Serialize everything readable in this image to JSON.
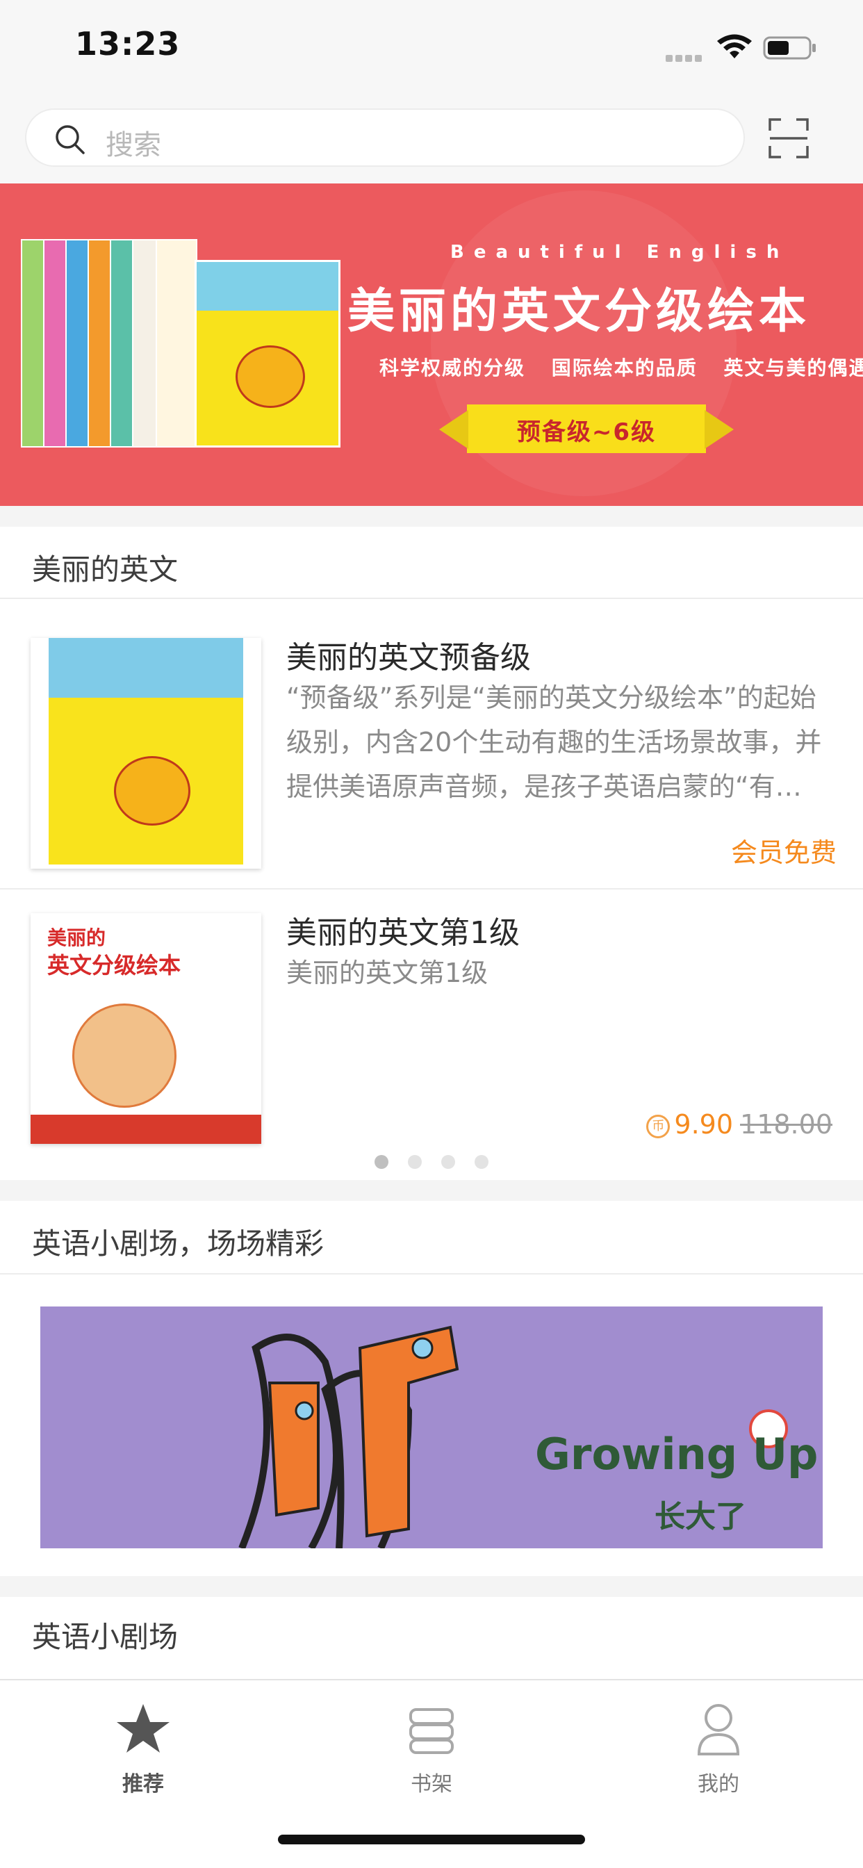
{
  "status_bar": {
    "time": "13:23"
  },
  "search": {
    "placeholder": "搜索"
  },
  "banner": {
    "kicker": "Beautiful English",
    "title": "美丽的英文分级绘本",
    "taglines": [
      "科学权威的分级",
      "国际绘本的品质",
      "英文与美的偶遇"
    ],
    "ribbon": "预备级~6级"
  },
  "section_beautiful_english": {
    "title": "美丽的英文",
    "books": [
      {
        "title": "美丽的英文预备级",
        "description": "“预备级”系列是“美丽的英文分级绘本”的起始级别，内含20个生动有趣的生活场景故事，并提供美语原声音频，是孩子英语启蒙的“有…",
        "badge": "会员免费"
      },
      {
        "title": "美丽的英文第1级",
        "description": "美丽的英文第1级",
        "price": "9.90",
        "original_price": "118.00",
        "coin_symbol": "币"
      }
    ],
    "pagination": {
      "count": 4,
      "active": 1
    }
  },
  "section_theater": {
    "title": "英语小剧场，场场精彩",
    "image_caption": "Growing Up",
    "image_caption_cn": "长大了"
  },
  "section_theater_2": {
    "title": "英语小剧场"
  },
  "tab_bar": {
    "tabs": [
      {
        "label": "推荐",
        "active": true
      },
      {
        "label": "书架",
        "active": false
      },
      {
        "label": "我的",
        "active": false
      }
    ]
  },
  "colors": {
    "accent_orange": "#f58a1e",
    "banner_red": "#ec5a5e",
    "ribbon_yellow": "#f9de1a"
  }
}
